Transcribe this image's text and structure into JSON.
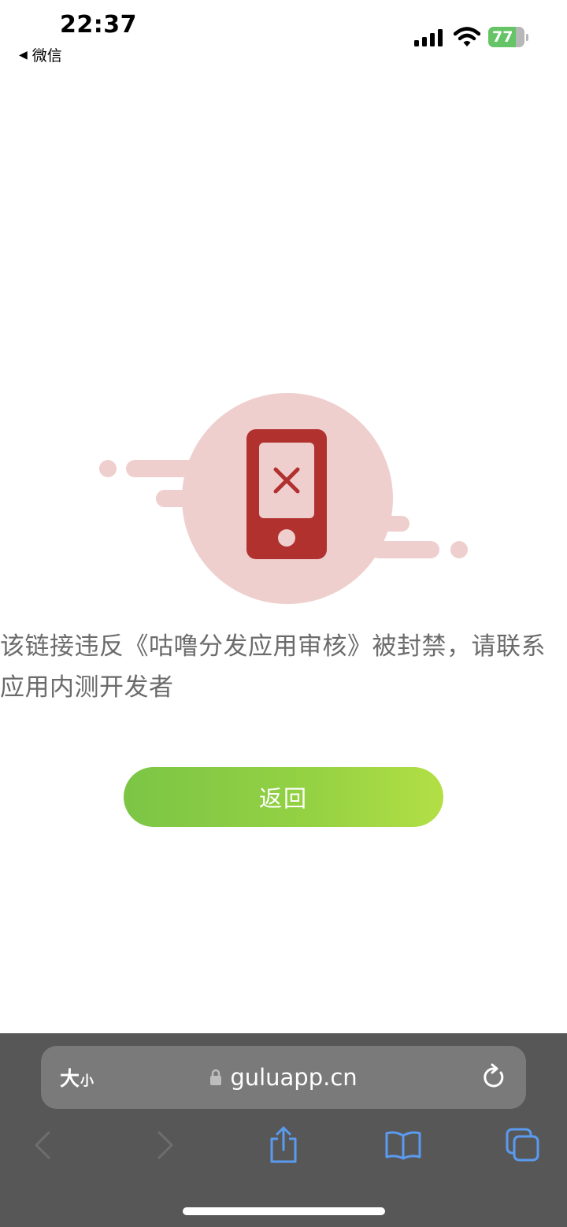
{
  "status_bar": {
    "time": "22:37",
    "back_app": "微信",
    "battery_level": "77",
    "battery_fraction": 0.77
  },
  "illustration": {
    "icon": "phone-blocked-icon",
    "colors": {
      "circle": "#efcfce",
      "phone": "#b0312e",
      "streaks": "#efcfce"
    }
  },
  "message": "该链接违反《咕噜分发应用审核》被封禁，请联系应用内测开发者",
  "back_button": {
    "label": "返回",
    "gradient": [
      "#7cc545",
      "#b3df45"
    ]
  },
  "browser": {
    "text_size_label": "大",
    "text_size_small": "小",
    "url": "guluapp.cn",
    "toolbar": [
      "back-icon",
      "forward-icon",
      "share-icon",
      "bookmarks-icon",
      "tabs-icon"
    ],
    "accent": "#5a9bf0"
  }
}
